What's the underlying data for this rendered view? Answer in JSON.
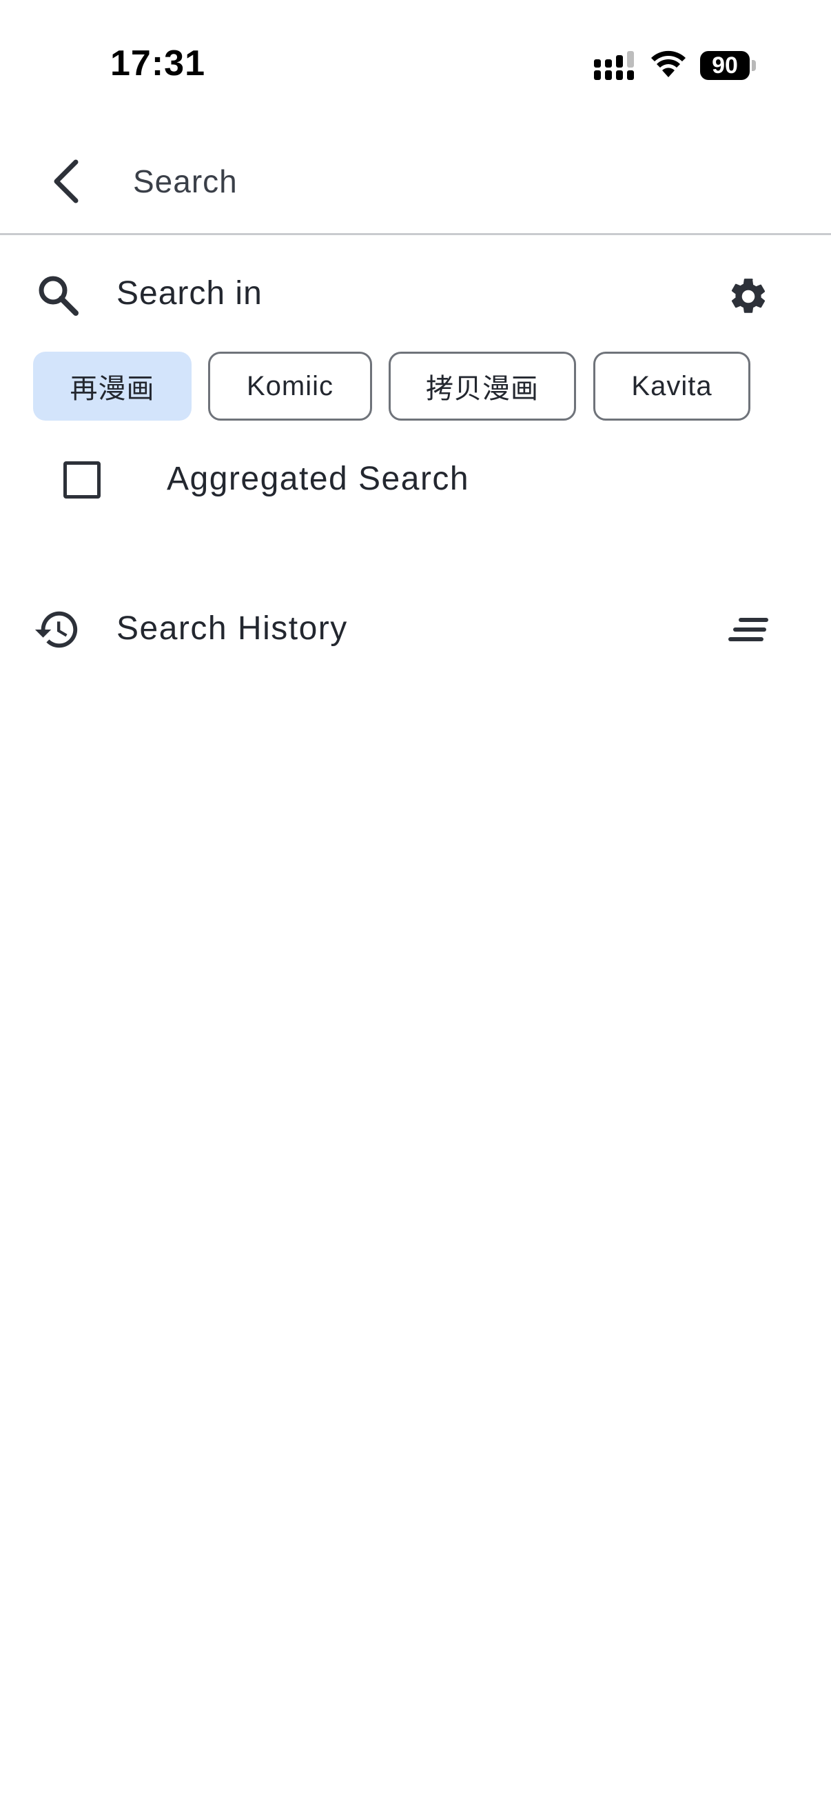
{
  "status_bar": {
    "time": "17:31",
    "battery": "90",
    "icons": [
      "cellular-signal-icon",
      "wifi-icon",
      "battery-icon"
    ]
  },
  "app_bar": {
    "title": "Search",
    "back_icon": "chevron-left-icon"
  },
  "search_in": {
    "label": "Search in",
    "icon": "search-icon",
    "settings_icon": "gear-icon",
    "sources": [
      {
        "label": "再漫画",
        "selected": true
      },
      {
        "label": "Komiic",
        "selected": false
      },
      {
        "label": "拷贝漫画",
        "selected": false
      },
      {
        "label": "Kavita",
        "selected": false
      }
    ]
  },
  "aggregated": {
    "label": "Aggregated Search",
    "checked": false
  },
  "history": {
    "label": "Search History",
    "icon": "history-icon",
    "sort_icon": "sort-icon"
  },
  "colors": {
    "selected_chip_bg": "#d3e4fb",
    "chip_border": "#6f737a",
    "text": "#23272f",
    "divider": "#c9cbcf"
  }
}
